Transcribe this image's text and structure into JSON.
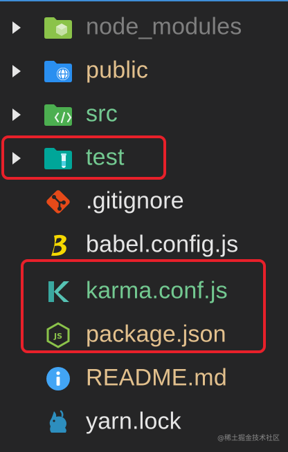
{
  "explorer": {
    "items": [
      {
        "label": "node_modules",
        "type": "folder",
        "icon": "node-modules-folder-icon",
        "color": "#7f7f7f"
      },
      {
        "label": "public",
        "type": "folder",
        "icon": "public-folder-icon",
        "color": "#e2c08d"
      },
      {
        "label": "src",
        "type": "folder",
        "icon": "src-folder-icon",
        "color": "#73c991"
      },
      {
        "label": "test",
        "type": "folder",
        "icon": "test-folder-icon",
        "color": "#73c991"
      },
      {
        "label": ".gitignore",
        "type": "file",
        "icon": "git-icon",
        "color": "#e6e6e6"
      },
      {
        "label": "babel.config.js",
        "type": "file",
        "icon": "babel-icon",
        "color": "#e6e6e6"
      },
      {
        "label": "karma.conf.js",
        "type": "file",
        "icon": "karma-icon",
        "color": "#73c991"
      },
      {
        "label": "package.json",
        "type": "file",
        "icon": "nodejs-icon",
        "color": "#e2c08d"
      },
      {
        "label": "README.md",
        "type": "file",
        "icon": "info-icon",
        "color": "#e2c08d"
      },
      {
        "label": "yarn.lock",
        "type": "file",
        "icon": "yarn-icon",
        "color": "#e6e6e6"
      }
    ]
  },
  "watermark": "@稀土掘金技术社区",
  "colors": {
    "background": "#252526",
    "highlight": "#e8202a",
    "accent_line": "#3f8fd9"
  }
}
